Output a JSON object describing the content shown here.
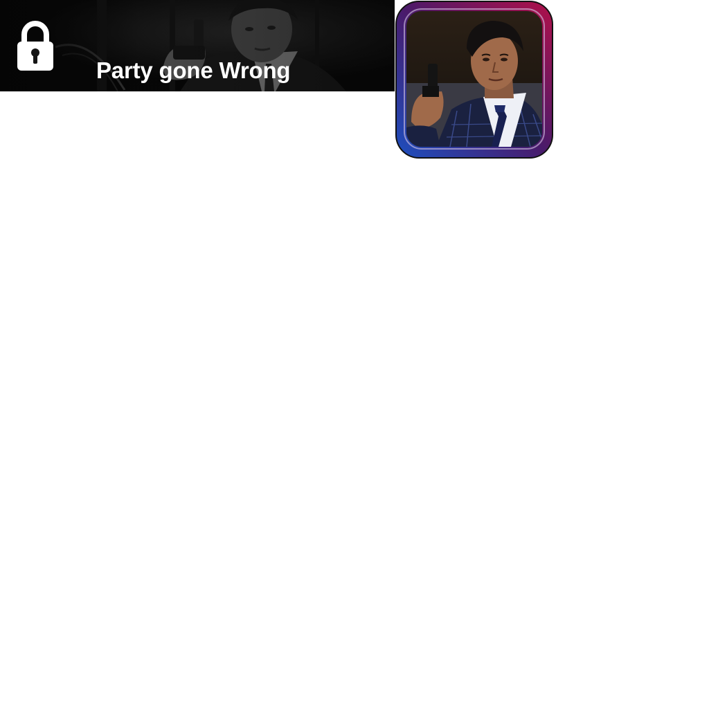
{
  "banner": {
    "title": "Party gone Wrong",
    "lock_icon": "lock-icon",
    "locked": true
  },
  "app_icon": {
    "icon": "app-icon-portrait",
    "frame_gradient": [
      "#b0104a",
      "#4a1a6a",
      "#1d4fbf"
    ]
  },
  "colors": {
    "banner_background": "#0b0b0b",
    "title_text": "#ffffff",
    "page_background": "#ffffff"
  }
}
